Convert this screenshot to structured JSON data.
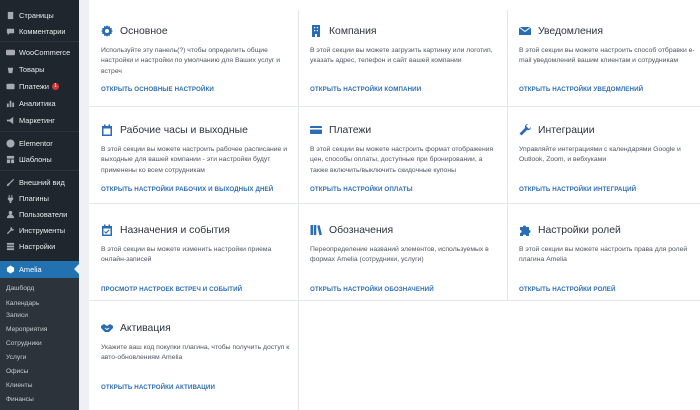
{
  "sidebar": {
    "top_items": [
      {
        "label": "Страницы",
        "icon": "pages-icon"
      },
      {
        "label": "Комментарии",
        "icon": "comments-icon"
      },
      {
        "label": "WooCommerce",
        "icon": "woocommerce-icon"
      },
      {
        "label": "Товары",
        "icon": "products-icon"
      },
      {
        "label": "Платежи",
        "icon": "payments-icon",
        "badge": "1"
      },
      {
        "label": "Аналитика",
        "icon": "analytics-icon"
      },
      {
        "label": "Маркетинг",
        "icon": "marketing-icon"
      },
      {
        "label": "Elementor",
        "icon": "elementor-icon"
      },
      {
        "label": "Шаблоны",
        "icon": "templates-icon"
      },
      {
        "label": "Внешний вид",
        "icon": "appearance-icon"
      },
      {
        "label": "Плагины",
        "icon": "plugins-icon"
      },
      {
        "label": "Пользователи",
        "icon": "users-icon"
      },
      {
        "label": "Инструменты",
        "icon": "tools-icon"
      },
      {
        "label": "Настройки",
        "icon": "settings-icon"
      }
    ],
    "active_item": {
      "label": "Amelia",
      "icon": "amelia-icon"
    },
    "submenu": [
      "Дашборд",
      "Календарь",
      "Записи",
      "Мероприятия",
      "Сотрудники",
      "Услуги",
      "Офисы",
      "Клиенты",
      "Финансы"
    ]
  },
  "cards": [
    {
      "title": "Основное",
      "icon": "gear-icon",
      "description": "Используйте эту панель(?) чтобы определить общие настройки и настройки по умолчанию для Ваших услуг и встреч",
      "link": "ОТКРЫТЬ ОСНОВНЫЕ НАСТРОЙКИ"
    },
    {
      "title": "Компания",
      "icon": "building-icon",
      "description": "В этой секции вы можете загрузить картинку или логотип, указать адрес, телефон и сайт вашей компании",
      "link": "ОТКРЫТЬ НАСТРОЙКИ КОМПАНИИ"
    },
    {
      "title": "Уведомления",
      "icon": "envelope-icon",
      "description": "В этой секции вы можете настроить способ отбравки e-mail уведомлений вашим клиентам и сотрудникам",
      "link": "ОТКРЫТЬ НАСТРОЙКИ УВЕДОМЛЕНИЙ"
    },
    {
      "title": "Рабочие часы и выходные",
      "icon": "calendar-icon",
      "description": "В этой секции вы можете настроить рабочее расписание и выходные для вашей компании - эти настройки будут применены ко всем сотрудникам",
      "link": "ОТКРЫТЬ НАСТРОЙКИ РАБОЧИХ И ВЫХОДНЫХ ДНЕЙ"
    },
    {
      "title": "Платежи",
      "icon": "credit-card-icon",
      "description": "В этой секции вы можете настроить формат отображения цен, способы оплаты, доступные при бронировании, а также включить/выключить скидочные купоны",
      "link": "ОТКРЫТЬ НАСТРОЙКИ ОПЛАТЫ"
    },
    {
      "title": "Интеграции",
      "icon": "wrench-icon",
      "description": "Управляйте интеграциями с календарями Google и Outlook, Zoom, и вебхуками",
      "link": "ОТКРЫТЬ НАСТРОЙКИ ИНТЕГРАЦИЙ"
    },
    {
      "title": "Назначения и события",
      "icon": "calendar-check-icon",
      "description": "В этой секции вы можете изменить настройки приема онлайн-записей",
      "link": "ПРОСМОТР НАСТРОЕК ВСТРЕЧ И СОБЫТИЙ"
    },
    {
      "title": "Обозначения",
      "icon": "books-icon",
      "description": "Переопределение названий элементов, используемых в формах Amelia (сотрудники, услуги)",
      "link": "ОТКРЫТЬ НАСТРОЙКИ ОБОЗНАЧЕНИЙ"
    },
    {
      "title": "Настройки ролей",
      "icon": "puzzle-icon",
      "description": "В этой секции вы можете настроить права для ролей плагина Amelia",
      "link": "ОТКРЫТЬ НАСТРОЙКИ РОЛЕЙ"
    },
    {
      "title": "Активация",
      "icon": "handshake-icon",
      "description": "Укажите ваш код покупки плагина, чтобы получить доступ к авто-обновлениям Amelia",
      "link": "ОТКРЫТЬ НАСТРОЙКИ АКТИВАЦИИ"
    }
  ]
}
